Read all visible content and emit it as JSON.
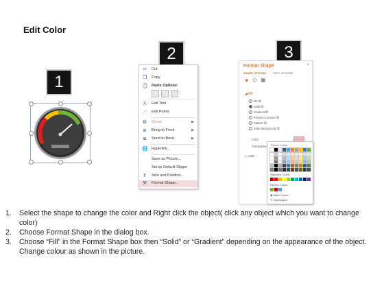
{
  "page_title": "Edit Color",
  "badges": [
    "1",
    "2",
    "3"
  ],
  "context_menu": {
    "items": [
      {
        "label": "Cut",
        "icon": "scissors-icon"
      },
      {
        "label": "Copy",
        "icon": "copy-icon"
      },
      {
        "label": "Paste Options:",
        "icon": "paste-icon"
      },
      {
        "label": "Edit Text",
        "icon": "edit-text-icon"
      },
      {
        "label": "Edit Points",
        "icon": "edit-points-icon"
      },
      {
        "label": "Group",
        "icon": "group-icon",
        "submenu": true
      },
      {
        "label": "Bring to Front",
        "icon": "bring-to-front-icon",
        "submenu": true
      },
      {
        "label": "Send to Back",
        "icon": "send-to-back-icon",
        "submenu": true
      },
      {
        "label": "Hyperlink...",
        "icon": "hyperlink-icon"
      },
      {
        "label": "Save as Picture...",
        "icon": ""
      },
      {
        "label": "Set as Default Shape",
        "icon": ""
      },
      {
        "label": "Size and Position...",
        "icon": "size-position-icon"
      },
      {
        "label": "Format Shape...",
        "icon": "format-shape-icon",
        "highlighted": true
      }
    ]
  },
  "format_shape": {
    "title": "Format Shape",
    "close": "×",
    "tabs": [
      "SHAPE OPTIONS",
      "TEXT OPTIONS"
    ],
    "fill_header": "◢ Fill",
    "fill_options": [
      "No fill",
      "Solid fill",
      "Gradient fill",
      "Picture or texture fill",
      "Pattern fill",
      "Slide background fill"
    ],
    "selected_fill": "Solid fill",
    "color_label": "Color",
    "transparency_label": "Transparency",
    "line_header": "▷ LINE",
    "dropdown": {
      "theme_label": "Theme Colors",
      "standard_label": "Standard Colors",
      "recent_label": "Recent Colors",
      "more_colors": "More Colors...",
      "eyedropper": "Eyedropper",
      "theme_colors": [
        "#ffffff",
        "#000000",
        "#e7e6e6",
        "#44546a",
        "#5b9bd5",
        "#ed7d31",
        "#a5a5a5",
        "#ffc000",
        "#4472c4",
        "#70ad47"
      ],
      "standard_colors": [
        "#c00000",
        "#ff0000",
        "#ffc000",
        "#ffff00",
        "#92d050",
        "#00b050",
        "#00b0f0",
        "#0070c0",
        "#002060",
        "#7030a0"
      ],
      "recent_colors": [
        "#70ad47",
        "#c00000",
        "#5b9bd5"
      ]
    }
  },
  "steps": [
    {
      "num": "1.",
      "text": "Select the shape to change the color and Right click the object( click any object which you want to change color)"
    },
    {
      "num": "2.",
      "text": "Choose Format Shape in the dialog box."
    },
    {
      "num": "3.",
      "text": "Choose “Fill” in the Format Shape box then “Solid” or “Gradient” depending on the appearance of the object. Change colour as shown in the picture."
    }
  ]
}
